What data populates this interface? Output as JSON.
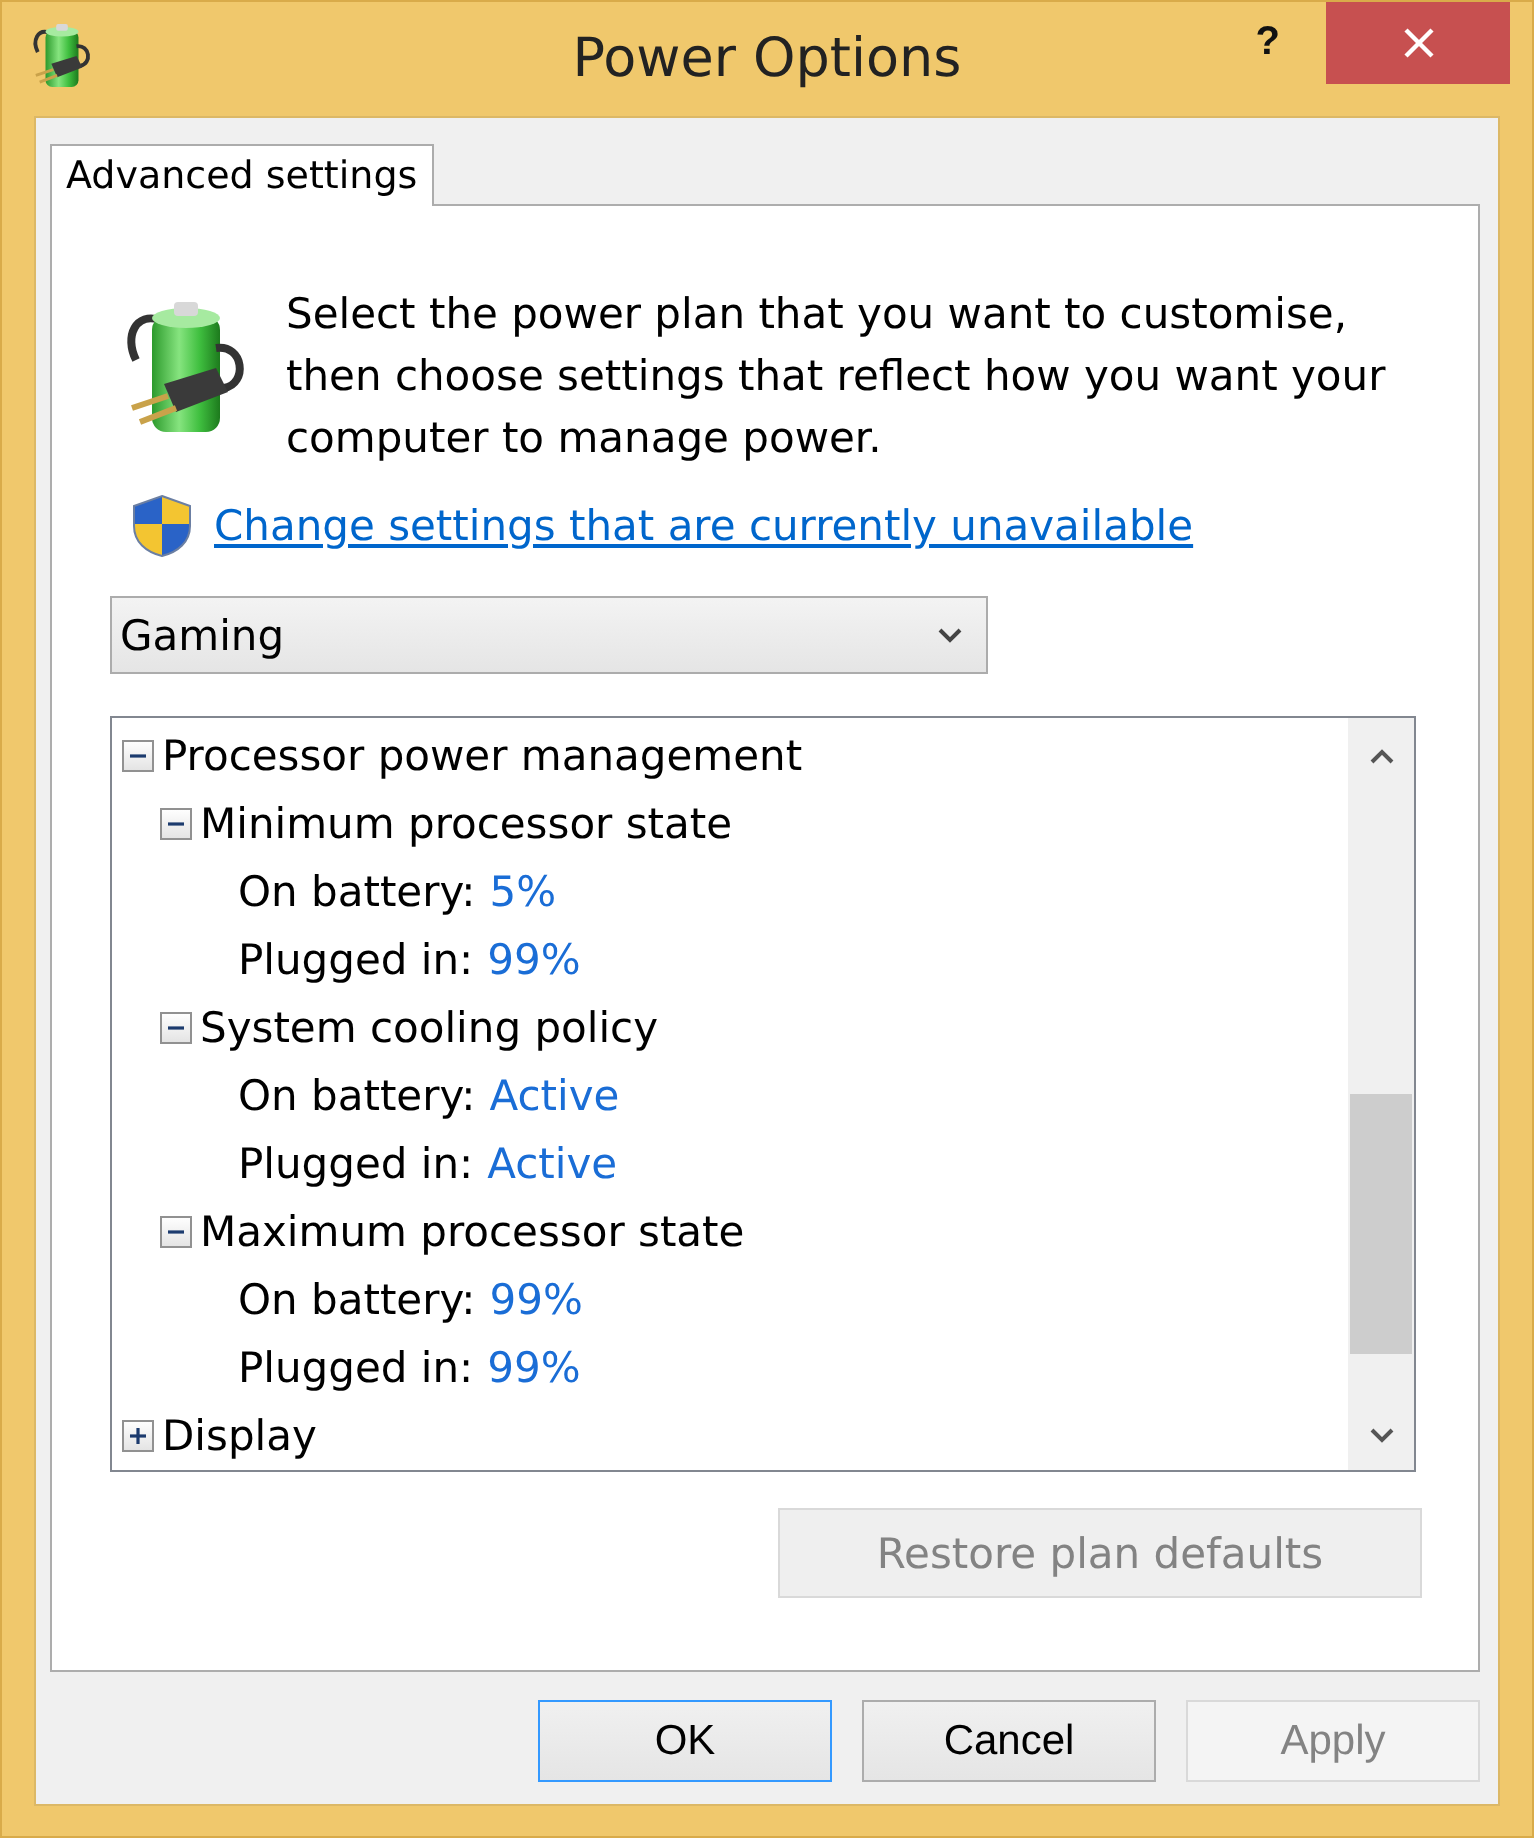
{
  "window": {
    "title": "Power Options",
    "help_button": "?"
  },
  "tabs": [
    {
      "label": "Advanced settings",
      "selected": true
    }
  ],
  "intro": "Select the power plan that you want to customise, then choose settings that reflect how you want your computer to manage power.",
  "link": "Change settings that are currently unavailable",
  "plan_dropdown": {
    "value": "Gaming"
  },
  "settings_tree": {
    "items": [
      {
        "label": "Processor power management",
        "expanded": true,
        "children": [
          {
            "label": "Minimum processor state",
            "expanded": true,
            "children": [
              {
                "label": "On battery:",
                "value": "5%"
              },
              {
                "label": "Plugged in:",
                "value": "99%"
              }
            ]
          },
          {
            "label": "System cooling policy",
            "expanded": true,
            "children": [
              {
                "label": "On battery:",
                "value": "Active"
              },
              {
                "label": "Plugged in:",
                "value": "Active"
              }
            ]
          },
          {
            "label": "Maximum processor state",
            "expanded": true,
            "children": [
              {
                "label": "On battery:",
                "value": "99%"
              },
              {
                "label": "Plugged in:",
                "value": "99%"
              }
            ]
          }
        ]
      },
      {
        "label": "Display",
        "expanded": false
      }
    ]
  },
  "restore_button": {
    "label": "Restore plan defaults",
    "disabled": true
  },
  "buttons": [
    {
      "label": "OK",
      "focused": true,
      "disabled": false
    },
    {
      "label": "Cancel",
      "focused": false,
      "disabled": false
    },
    {
      "label": "Apply",
      "focused": false,
      "disabled": true
    }
  ]
}
